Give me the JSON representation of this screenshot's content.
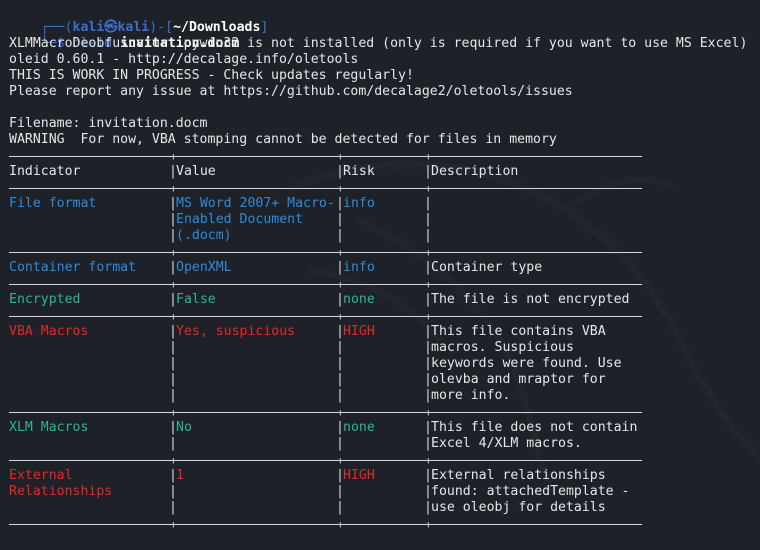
{
  "prompt": {
    "corner_top": "┌──(",
    "user": "kali㉿kali",
    "mid": ")-[",
    "dir": "~/Downloads",
    "end": "]",
    "corner_bottom": "└─$ ",
    "command": "oleid",
    "argument": "invitation.docm"
  },
  "output_lines": [
    "XLMMacroDeobfuscator: pywin32 is not installed (only is required if you want to use MS Excel)",
    "oleid 0.60.1 - http://decalage.info/oletools",
    "THIS IS WORK IN PROGRESS - Check updates regularly!",
    "Please report any issue at https://github.com/decalage2/oletools/issues",
    "",
    "Filename: invitation.docm",
    "WARNING  For now, VBA stomping cannot be detected for files in memory"
  ],
  "table": {
    "headers": [
      "Indicator",
      "Value",
      "Risk",
      "Description"
    ],
    "rows": [
      {
        "color": "blue",
        "indicator": [
          "File format"
        ],
        "value": [
          "MS Word 2007+ Macro-",
          "Enabled Document",
          "(.docm)"
        ],
        "risk": [
          "info"
        ],
        "description": []
      },
      {
        "color": "blue",
        "indicator": [
          "Container format"
        ],
        "value": [
          "OpenXML"
        ],
        "risk": [
          "info"
        ],
        "description": [
          "Container type"
        ]
      },
      {
        "color": "green",
        "indicator": [
          "Encrypted"
        ],
        "value": [
          "False"
        ],
        "risk": [
          "none"
        ],
        "description": [
          "The file is not encrypted"
        ]
      },
      {
        "color": "red",
        "indicator": [
          "VBA Macros"
        ],
        "value": [
          "Yes, suspicious"
        ],
        "risk": [
          "HIGH"
        ],
        "description": [
          "This file contains VBA",
          "macros. Suspicious",
          "keywords were found. Use",
          "olevba and mraptor for",
          "more info."
        ]
      },
      {
        "color": "green",
        "indicator": [
          "XLM Macros"
        ],
        "value": [
          "No"
        ],
        "risk": [
          "none"
        ],
        "description": [
          "This file does not contain",
          "Excel 4/XLM macros."
        ]
      },
      {
        "color": "red",
        "indicator": [
          "External",
          "Relationships"
        ],
        "value": [
          "1"
        ],
        "risk": [
          "HIGH"
        ],
        "description": [
          "External relationships",
          "found: attachedTemplate -",
          "use oleobj for details"
        ]
      }
    ]
  },
  "colors": {
    "background": "#1e2127",
    "text": "#e6e6e6",
    "info_blue": "#2f8bd8",
    "none_green": "#2bb68f",
    "high_red": "#df2a2a",
    "prompt_blue": "#3a6fd0"
  }
}
